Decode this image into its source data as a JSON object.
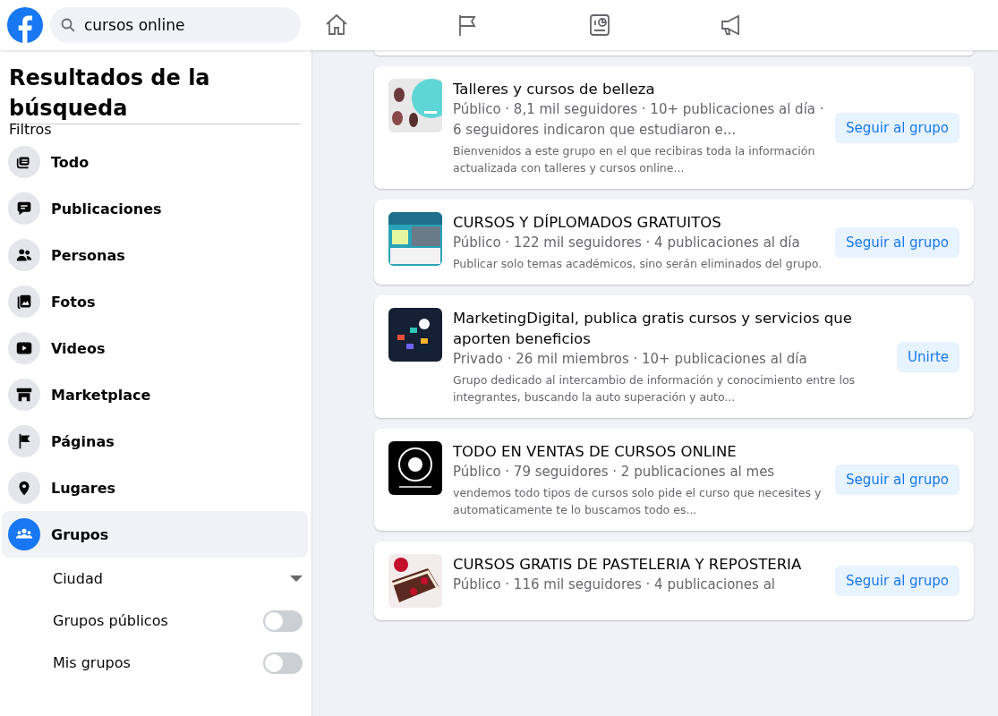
{
  "search": {
    "value": "cursos online"
  },
  "sidebar": {
    "title": "Resultados de la búsqueda",
    "section": "Filtros",
    "filters": [
      {
        "label": "Todo",
        "selected": false
      },
      {
        "label": "Publicaciones",
        "selected": false
      },
      {
        "label": "Personas",
        "selected": false
      },
      {
        "label": "Fotos",
        "selected": false
      },
      {
        "label": "Videos",
        "selected": false
      },
      {
        "label": "Marketplace",
        "selected": false
      },
      {
        "label": "Páginas",
        "selected": false
      },
      {
        "label": "Lugares",
        "selected": false
      },
      {
        "label": "Grupos",
        "selected": true
      }
    ],
    "options": [
      {
        "kind": "dropdown",
        "label": "Ciudad"
      },
      {
        "kind": "toggle",
        "label": "Grupos públicos",
        "on": false
      },
      {
        "kind": "toggle",
        "label": "Mis grupos",
        "on": false
      }
    ]
  },
  "results": [
    {
      "name": "Talleres y cursos de belleza",
      "meta": "Público · 8,1 mil seguidores · 10+ publicaciones al día · 6 seguidores indicaron que estudiaron e...",
      "description": "Bienvenidos a este grupo en el que recibiras toda la información actualizada con talleres y cursos online...",
      "action": "Seguir al grupo"
    },
    {
      "name": "CURSOS Y DÍPLOMADOS GRATUITOS",
      "meta": "Público · 122 mil seguidores · 4 publicaciones al día",
      "description": "Publicar solo temas académicos, sino serán eliminados del grupo.",
      "action": "Seguir al grupo"
    },
    {
      "name": "MarketingDigital, publica gratis cursos y servicios que aporten beneficios",
      "meta": "Privado · 26 mil miembros · 10+ publicaciones al día",
      "description": "Grupo dedicado al intercambio de información y conocimiento entre los integrantes, buscando la auto superación y auto...",
      "action": "Unirte"
    },
    {
      "name": "TODO EN VENTAS DE CURSOS ONLINE",
      "meta": "Público · 79 seguidores · 2 publicaciones al mes",
      "description": "vendemos todo tipos de cursos solo pide el curso que necesites y automaticamente te lo buscamos todo es...",
      "action": "Seguir al grupo"
    },
    {
      "name": "CURSOS GRATIS DE PASTELERIA Y REPOSTERIA",
      "meta": "Público · 116 mil seguidores · 4 publicaciones al",
      "action": "Seguir al grupo"
    }
  ]
}
